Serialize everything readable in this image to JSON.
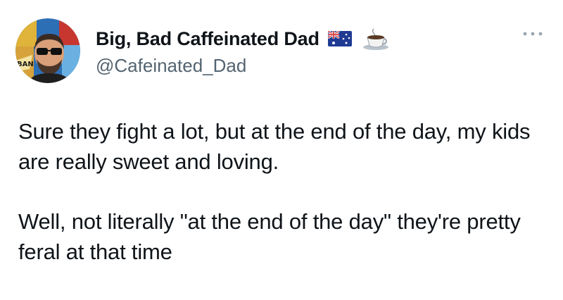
{
  "author": {
    "display_name": "Big, Bad Caffeinated Dad",
    "handle": "@Cafeinated_Dad",
    "name_emojis": [
      "australia-flag-icon",
      "coffee-icon"
    ],
    "avatar_badge_text": "BAN"
  },
  "tweet": {
    "paragraphs": [
      "Sure they fight a lot, but at the end of the day, my kids are really sweet and loving.",
      "Well, not literally \"at the end of the day\" they're pretty feral at that time"
    ]
  },
  "colors": {
    "text_primary": "#0f1419",
    "text_secondary": "#536471",
    "background": "#ffffff"
  }
}
